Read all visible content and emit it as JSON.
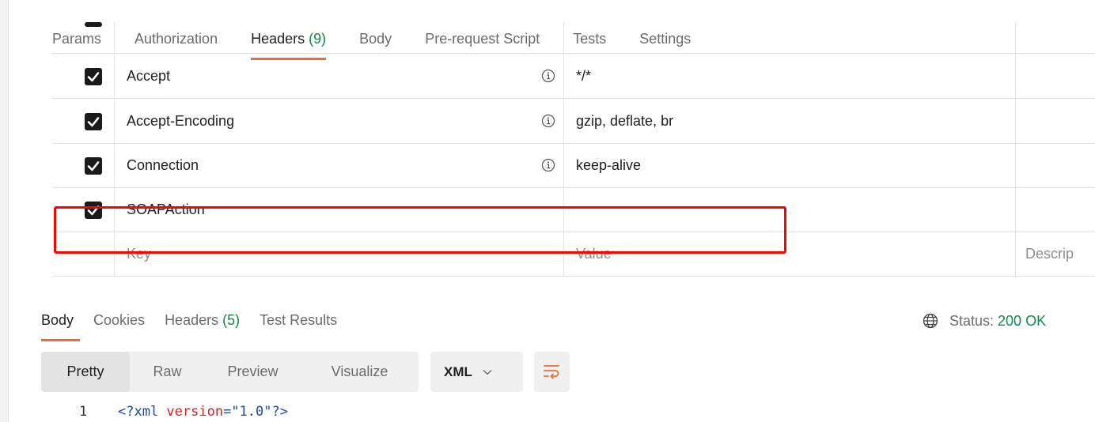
{
  "request_tabs": [
    {
      "label": "Params",
      "count": ""
    },
    {
      "label": "Authorization",
      "count": ""
    },
    {
      "label": "Headers",
      "count": "(9)"
    },
    {
      "label": "Body",
      "count": ""
    },
    {
      "label": "Pre-request Script",
      "count": ""
    },
    {
      "label": "Tests",
      "count": ""
    },
    {
      "label": "Settings",
      "count": ""
    }
  ],
  "headers": {
    "rows": [
      {
        "key": "Accept",
        "value": "*/*",
        "checked": true,
        "info": true
      },
      {
        "key": "Accept-Encoding",
        "value": "gzip, deflate, br",
        "checked": true,
        "info": true
      },
      {
        "key": "Connection",
        "value": "keep-alive",
        "checked": true,
        "info": true
      },
      {
        "key": "SOAPAction",
        "value": "",
        "checked": true,
        "info": false
      }
    ],
    "new_row": {
      "key_placeholder": "Key",
      "value_placeholder": "Value",
      "description_placeholder": "Descrip"
    }
  },
  "response_tabs": [
    {
      "label": "Body",
      "count": ""
    },
    {
      "label": "Cookies",
      "count": ""
    },
    {
      "label": "Headers",
      "count": "(5)"
    },
    {
      "label": "Test Results",
      "count": ""
    }
  ],
  "status": {
    "label": "Status:",
    "value": "200 OK"
  },
  "view_modes": [
    "Pretty",
    "Raw",
    "Preview",
    "Visualize"
  ],
  "format": "XML",
  "code": {
    "line_number": "1",
    "open": "<?xml ",
    "attr": "version",
    "eq": "=",
    "value": "\"1.0\"",
    "close": "?>"
  },
  "colors": {
    "accent": "#f26b3a",
    "success": "#0f8a4a",
    "highlight": "#ff0000"
  }
}
